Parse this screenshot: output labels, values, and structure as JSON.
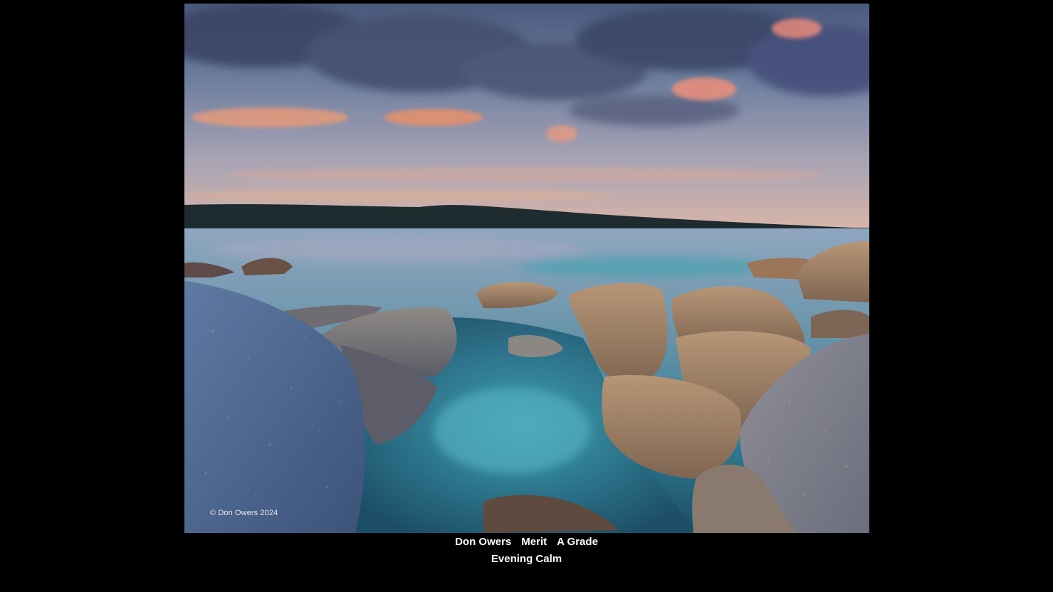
{
  "photo": {
    "copyright": "© Don Owers 2024"
  },
  "caption": {
    "author": "Don Owers",
    "award": "Merit",
    "grade": "A Grade",
    "title": "Evening Calm"
  },
  "colors": {
    "background": "#000000",
    "caption_text": "#ffffff"
  }
}
